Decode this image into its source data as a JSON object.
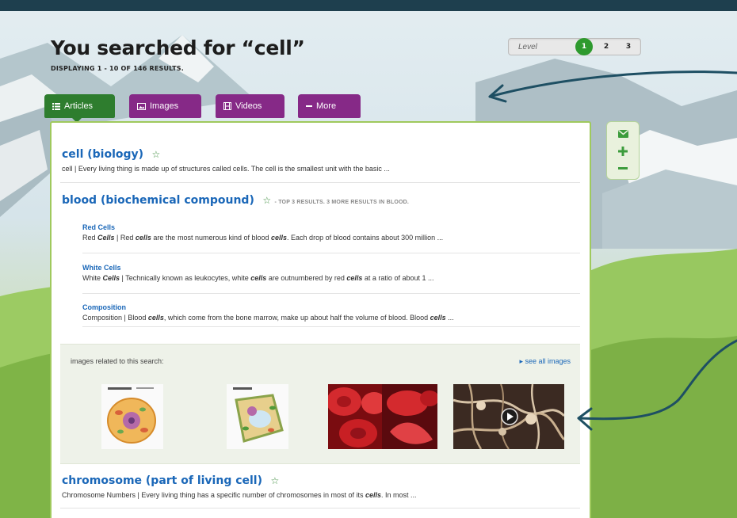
{
  "header": {
    "title": "You searched for “cell”",
    "results_count": "DISPLAYING 1 - 10 OF 146 RESULTS."
  },
  "level": {
    "label": "Level",
    "options": [
      "1",
      "2",
      "3"
    ],
    "selected": "1"
  },
  "tabs": [
    {
      "label": "Articles",
      "icon": "list-icon",
      "active": true
    },
    {
      "label": "Images",
      "icon": "image-icon",
      "active": false
    },
    {
      "label": "Videos",
      "icon": "film-icon",
      "active": false
    },
    {
      "label": "More",
      "icon": "dash-icon",
      "active": false
    }
  ],
  "tools": [
    "mail-icon",
    "plus-icon",
    "minus-icon"
  ],
  "results": {
    "cell": {
      "title": "cell (biology)",
      "snippet": "cell  |  Every living thing is made up of structures called cells. The cell is the smallest unit with the basic ..."
    },
    "blood": {
      "title": "blood (biochemical compound)",
      "note": "- TOP 3 RESULTS. 3 MORE RESULTS IN BLOOD.",
      "subs": [
        {
          "title": "Red Cells",
          "snippet": "Red Cells  |  Red cells are the most numerous kind of blood cells. Each drop of blood contains about 300 million ..."
        },
        {
          "title": "White Cells",
          "snippet": "White Cells  |  Technically known as leukocytes, white cells are outnumbered by red cells at a ratio of about 1 ..."
        },
        {
          "title": "Composition",
          "snippet": "Composition  |  Blood cells, which come from the bone marrow, make up about half the volume of blood. Blood cells ..."
        }
      ]
    },
    "chromosome": {
      "title": "chromosome (part of living cell)",
      "snippet": "Chromosome Numbers  |  Every living thing has a specific number of chromosomes in most of its cells. In most ..."
    }
  },
  "images_section": {
    "label": "images related to this search:",
    "see_all": "▸ see all images",
    "thumbnails": [
      "animal-cell-diagram",
      "plant-cell-diagram",
      "red-blood-cells-photo",
      "nerve-cells-video"
    ]
  },
  "colors": {
    "topbar": "#1e3f4e",
    "articles_tab": "#2e7d2e",
    "other_tabs": "#862987",
    "link": "#1a67b8",
    "panel_border": "#9fc95d",
    "arrow": "#1e4f63"
  }
}
